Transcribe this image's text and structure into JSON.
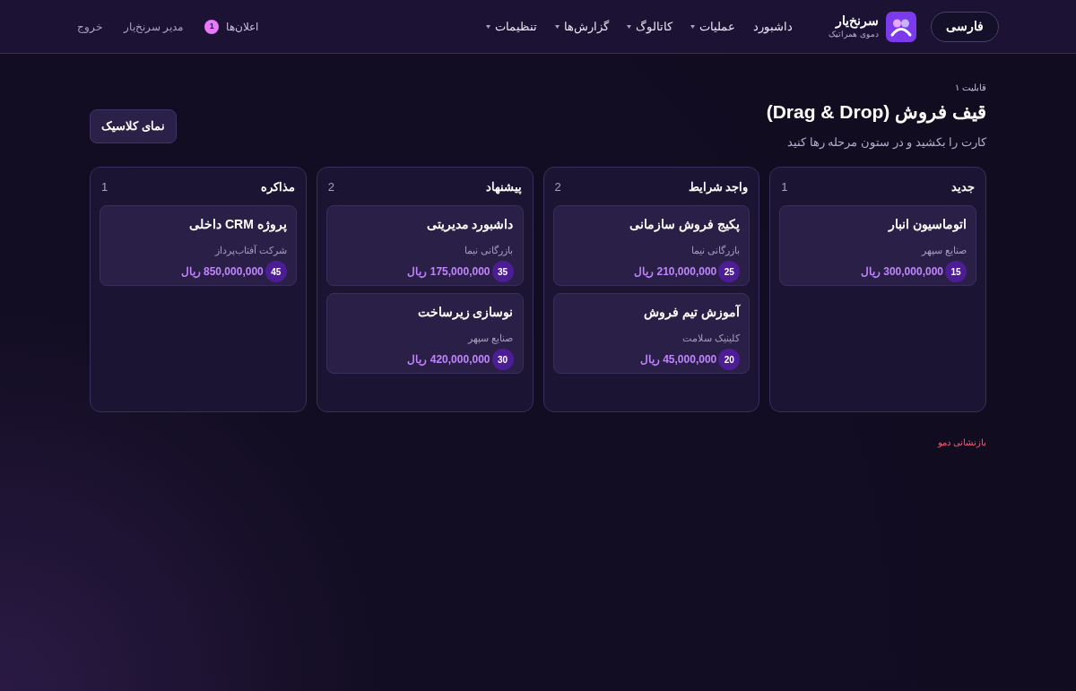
{
  "header": {
    "language_button": "فارسی",
    "brand": {
      "name": "سرنخ‌یار",
      "subtitle": "دموی همراتیک"
    },
    "nav": [
      {
        "label": "داشبورد",
        "has_menu": false
      },
      {
        "label": "عملیات",
        "has_menu": true
      },
      {
        "label": "کاتالوگ",
        "has_menu": true
      },
      {
        "label": "گزارش‌ها",
        "has_menu": true
      },
      {
        "label": "تنظیمات",
        "has_menu": true
      }
    ],
    "notifications": {
      "label": "اعلان‌ها",
      "count": "1"
    },
    "user": "مدیر سرنخ‌یار",
    "logout": "خروج"
  },
  "breadcrumb": "قابلیت ۱",
  "title": "قیف فروش (Drag & Drop)",
  "subtitle": "کارت را بکشید و در ستون مرحله رها کنید",
  "classic_button": "نمای کلاسیک",
  "columns": [
    {
      "title": "جدید",
      "count": "1",
      "cards": [
        {
          "title": "اتوماسیون انبار",
          "company": "صنایع سپهر",
          "amount": "300,000,000 ریال",
          "probability": "15"
        }
      ]
    },
    {
      "title": "واجد شرایط",
      "count": "2",
      "cards": [
        {
          "title": "پکیج فروش سازمانی",
          "company": "بازرگانی نیما",
          "amount": "210,000,000 ریال",
          "probability": "25"
        },
        {
          "title": "آموزش تیم فروش",
          "company": "کلینیک سلامت",
          "amount": "45,000,000 ریال",
          "probability": "20"
        }
      ]
    },
    {
      "title": "پیشنهاد",
      "count": "2",
      "cards": [
        {
          "title": "داشبورد مدیریتی",
          "company": "بازرگانی نیما",
          "amount": "175,000,000 ریال",
          "probability": "35"
        },
        {
          "title": "نوسازی زیرساخت",
          "company": "صنایع سپهر",
          "amount": "420,000,000 ریال",
          "probability": "30"
        }
      ]
    },
    {
      "title": "مذاکره",
      "count": "1",
      "cards": [
        {
          "title": "پروژه CRM داخلی",
          "company": "شرکت آفتاب‌پرداز",
          "amount": "850,000,000 ریال",
          "probability": "45"
        }
      ]
    }
  ],
  "reset_link": "بازنشانی دمو"
}
